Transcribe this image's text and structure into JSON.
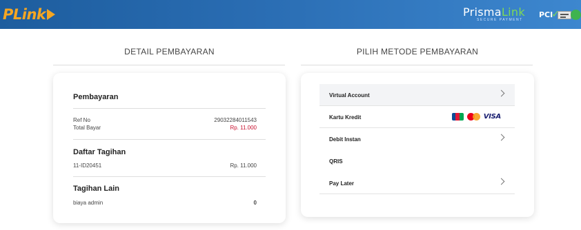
{
  "header": {
    "logo_text": "PLink",
    "brand_name_prefix": "Prisma",
    "brand_name_suffix": "Link",
    "brand_tagline": "SECURE PAYMENT",
    "pci_label": "PCI",
    "pci_check": "✓"
  },
  "colors": {
    "header_bg": "#2a6db3",
    "logo_accent": "#f5a623",
    "total_red": "#c8102e",
    "active_row_bg": "#f3f4f6"
  },
  "detail": {
    "section_title": "DETAIL PEMBAYARAN",
    "payment_heading": "Pembayaran",
    "ref_label": "Ref No",
    "ref_value": "29032284011543",
    "total_label": "Total Bayar",
    "total_value": "Rp. 11.000",
    "bills_heading": "Daftar Tagihan",
    "bill_id": "11-ID20451",
    "bill_amount": "Rp. 11.000",
    "other_heading": "Tagihan Lain",
    "admin_label": "biaya admin",
    "admin_value": "0"
  },
  "methods": {
    "section_title": "PILIH METODE PEMBAYARAN",
    "items": [
      {
        "label": "Virtual Account",
        "icon": "chevron-right-icon",
        "active": true
      },
      {
        "label": "Kartu Kredit",
        "icon": "card-logos",
        "active": false
      },
      {
        "label": "Debit Instan",
        "icon": "chevron-right-icon",
        "active": false
      },
      {
        "label": "QRIS",
        "icon": "",
        "active": false
      },
      {
        "label": "Pay Later",
        "icon": "chevron-right-icon",
        "active": false
      }
    ],
    "card_logos": {
      "jcb": "JCB",
      "mastercard": "Mastercard",
      "visa": "VISA"
    }
  }
}
